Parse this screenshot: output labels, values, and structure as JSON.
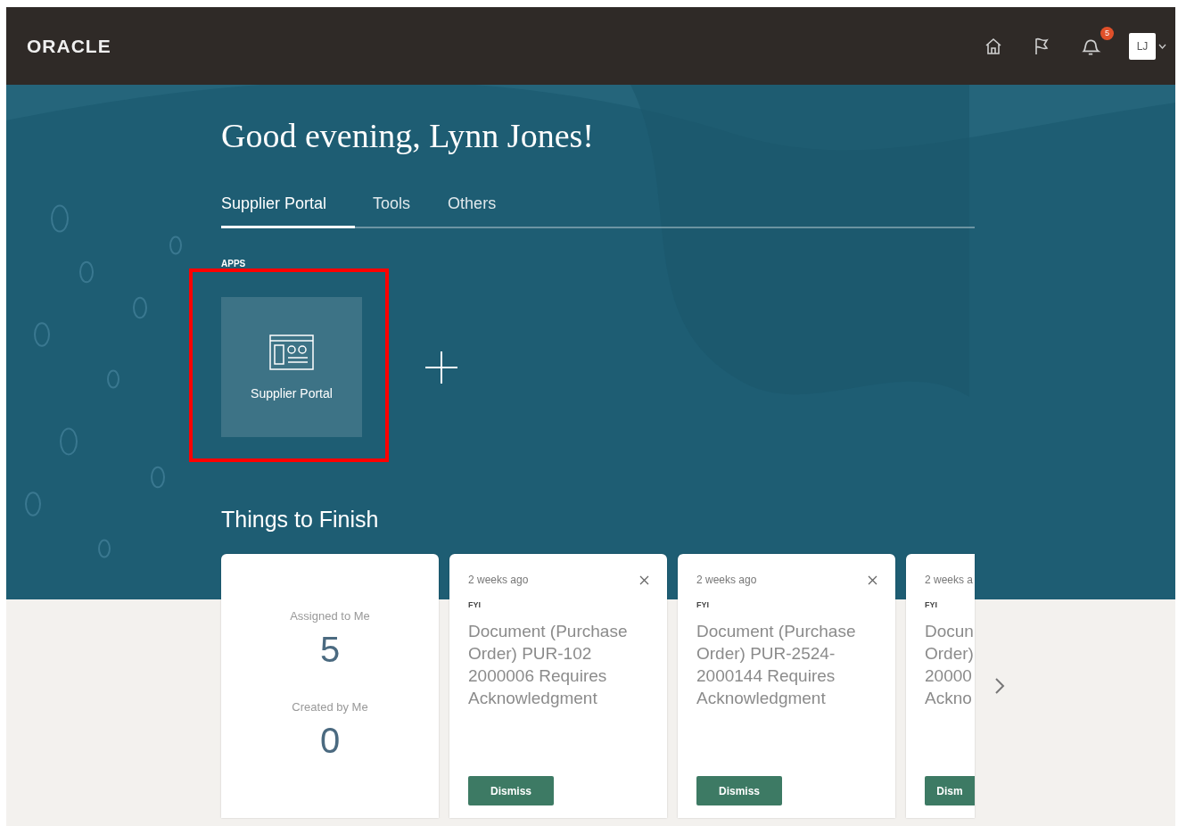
{
  "header": {
    "logo": "ORACLE",
    "notifications_badge": "5",
    "avatar": "LJ"
  },
  "greeting": "Good evening, Lynn Jones!",
  "tabs": [
    {
      "label": "Supplier Portal",
      "selected": true
    },
    {
      "label": "Tools",
      "selected": false
    },
    {
      "label": "Others",
      "selected": false
    }
  ],
  "apps": {
    "heading": "APPS",
    "tiles": [
      {
        "label": "Supplier Portal",
        "highlighted": true
      }
    ]
  },
  "things_to_finish": {
    "heading": "Things to Finish",
    "cards": [
      {
        "kind": "summary",
        "assigned_label": "Assigned to Me",
        "assigned_count": "5",
        "created_label": "Created by Me",
        "created_count": "0"
      },
      {
        "kind": "task",
        "time": "2 weeks ago",
        "type": "FYI",
        "title_lines": [
          "Document (Purchase",
          "Order) PUR-102",
          "2000006 Requires",
          "Acknowledgment"
        ],
        "button": "Dismiss"
      },
      {
        "kind": "task",
        "time": "2 weeks ago",
        "type": "FYI",
        "title_lines": [
          "Document (Purchase",
          "Order) PUR-2524-",
          "2000144 Requires",
          "Acknowledgment"
        ],
        "button": "Dismiss"
      },
      {
        "kind": "partial",
        "time": "2 weeks a",
        "type": "FYI",
        "title_lines": [
          "Docun",
          "Order)",
          "20000",
          "Ackno"
        ],
        "button": "Dism"
      }
    ]
  }
}
